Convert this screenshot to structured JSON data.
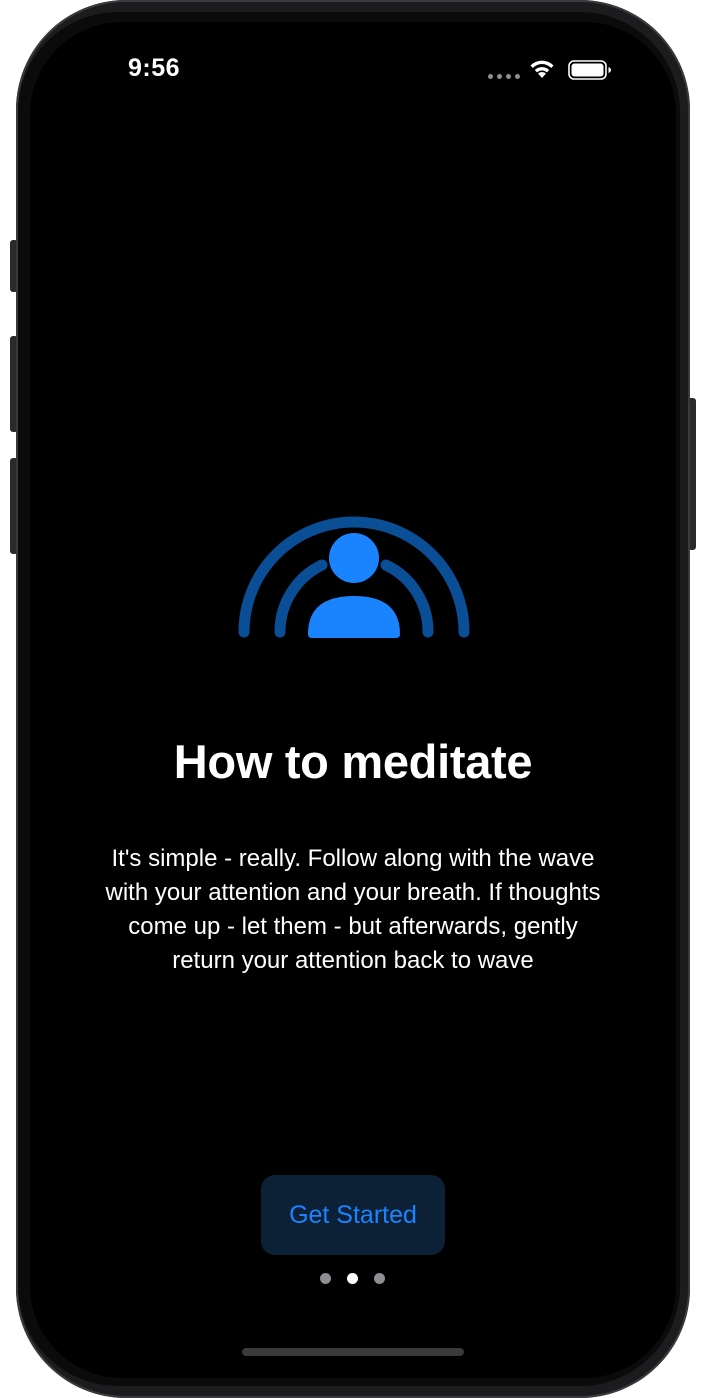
{
  "status_bar": {
    "time": "9:56",
    "icons": [
      "cellular-dots-icon",
      "wifi-icon",
      "battery-icon"
    ]
  },
  "onboarding": {
    "icon": "person-wave-icon",
    "title": "How to meditate",
    "description": "It's simple - really.  Follow along with the wave\nwith your attention and your breath. If thoughts\ncome up - let them - but afterwards, gently\nreturn your attention back to wave",
    "button_label": "Get Started",
    "page_count": 3,
    "current_page": 2
  },
  "colors": {
    "accent": "#1a84ff",
    "accent_dark": "#0a4f96",
    "button_bg": "#0d2136",
    "background": "#000000",
    "text": "#ffffff",
    "inactive_dot": "#8e8e93"
  }
}
